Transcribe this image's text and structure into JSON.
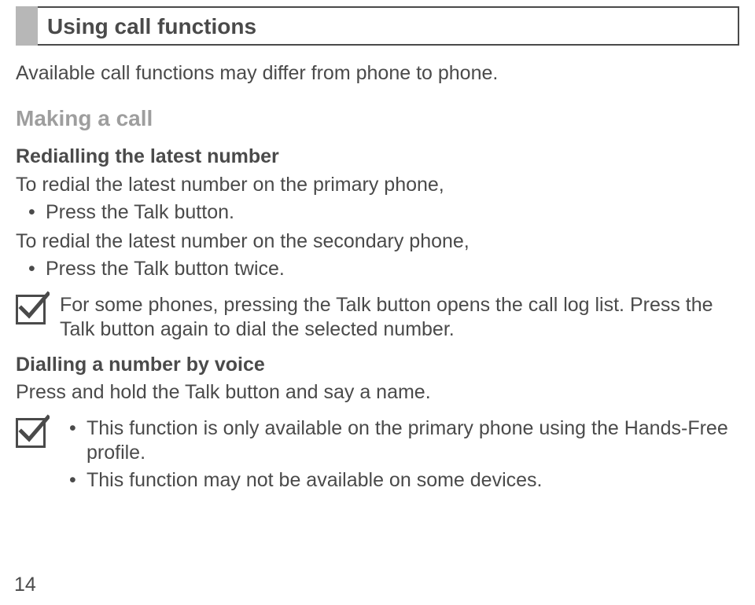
{
  "title": "Using call functions",
  "intro": "Available call functions may differ from phone to phone.",
  "section_title": "Making a call",
  "redial": {
    "heading": "Redialling the latest number",
    "primary_text": "To redial the latest number on the primary phone,",
    "primary_bullet": "Press the Talk button.",
    "secondary_text": "To redial the latest number on the secondary phone,",
    "secondary_bullet": "Press the Talk button twice."
  },
  "note1": "For some phones, pressing the Talk button opens the call log list. Press the Talk button again to dial the selected number.",
  "voice": {
    "heading": "Dialling a number by voice",
    "body": "Press and hold the Talk button and say a name."
  },
  "note2": {
    "b1": "This function is only available on the primary phone using the Hands-Free profile.",
    "b2": "This function may not be available on some devices."
  },
  "page_number": "14"
}
